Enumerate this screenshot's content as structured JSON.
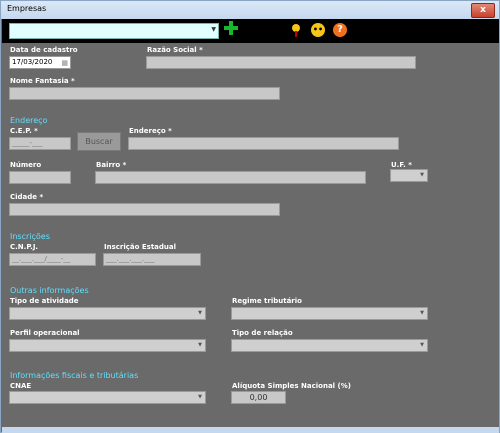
{
  "window": {
    "title": "Empresas",
    "close": "x"
  },
  "toolbar": {
    "company_select_value": "",
    "face_glyph": "••",
    "help_glyph": "?"
  },
  "labels": {
    "data_cadastro": "Data de cadastro",
    "razao_social": "Razão Social *",
    "nome_fantasia": "Nome Fantasia *",
    "cep": "C.E.P. *",
    "endereco": "Endereço *",
    "numero": "Número",
    "bairro": "Bairro *",
    "uf": "U.F. *",
    "cidade": "Cidade *",
    "cnpj": "C.N.P.J.",
    "inscricao_estadual": "Inscrição Estadual",
    "tipo_atividade": "Tipo de atividade",
    "regime_tributario": "Regime tributário",
    "perfil_operacional": "Perfil operacional",
    "tipo_relacao": "Tipo de relação",
    "cnae": "CNAE",
    "aliquota": "Alíquota Simples Nacional (%)"
  },
  "sections": {
    "endereco": "Endereço",
    "inscricoes": "Inscrições",
    "outras": "Outras informações",
    "fiscais": "Informações fiscais e tributárias"
  },
  "values": {
    "data_cadastro": "17/03/2020",
    "cep_mask": "_____-___",
    "cnpj_mask": "__.___.___/____-__",
    "ie_mask": "___.___.___.___",
    "aliquota": "0,00"
  },
  "buttons": {
    "buscar": "Buscar"
  }
}
